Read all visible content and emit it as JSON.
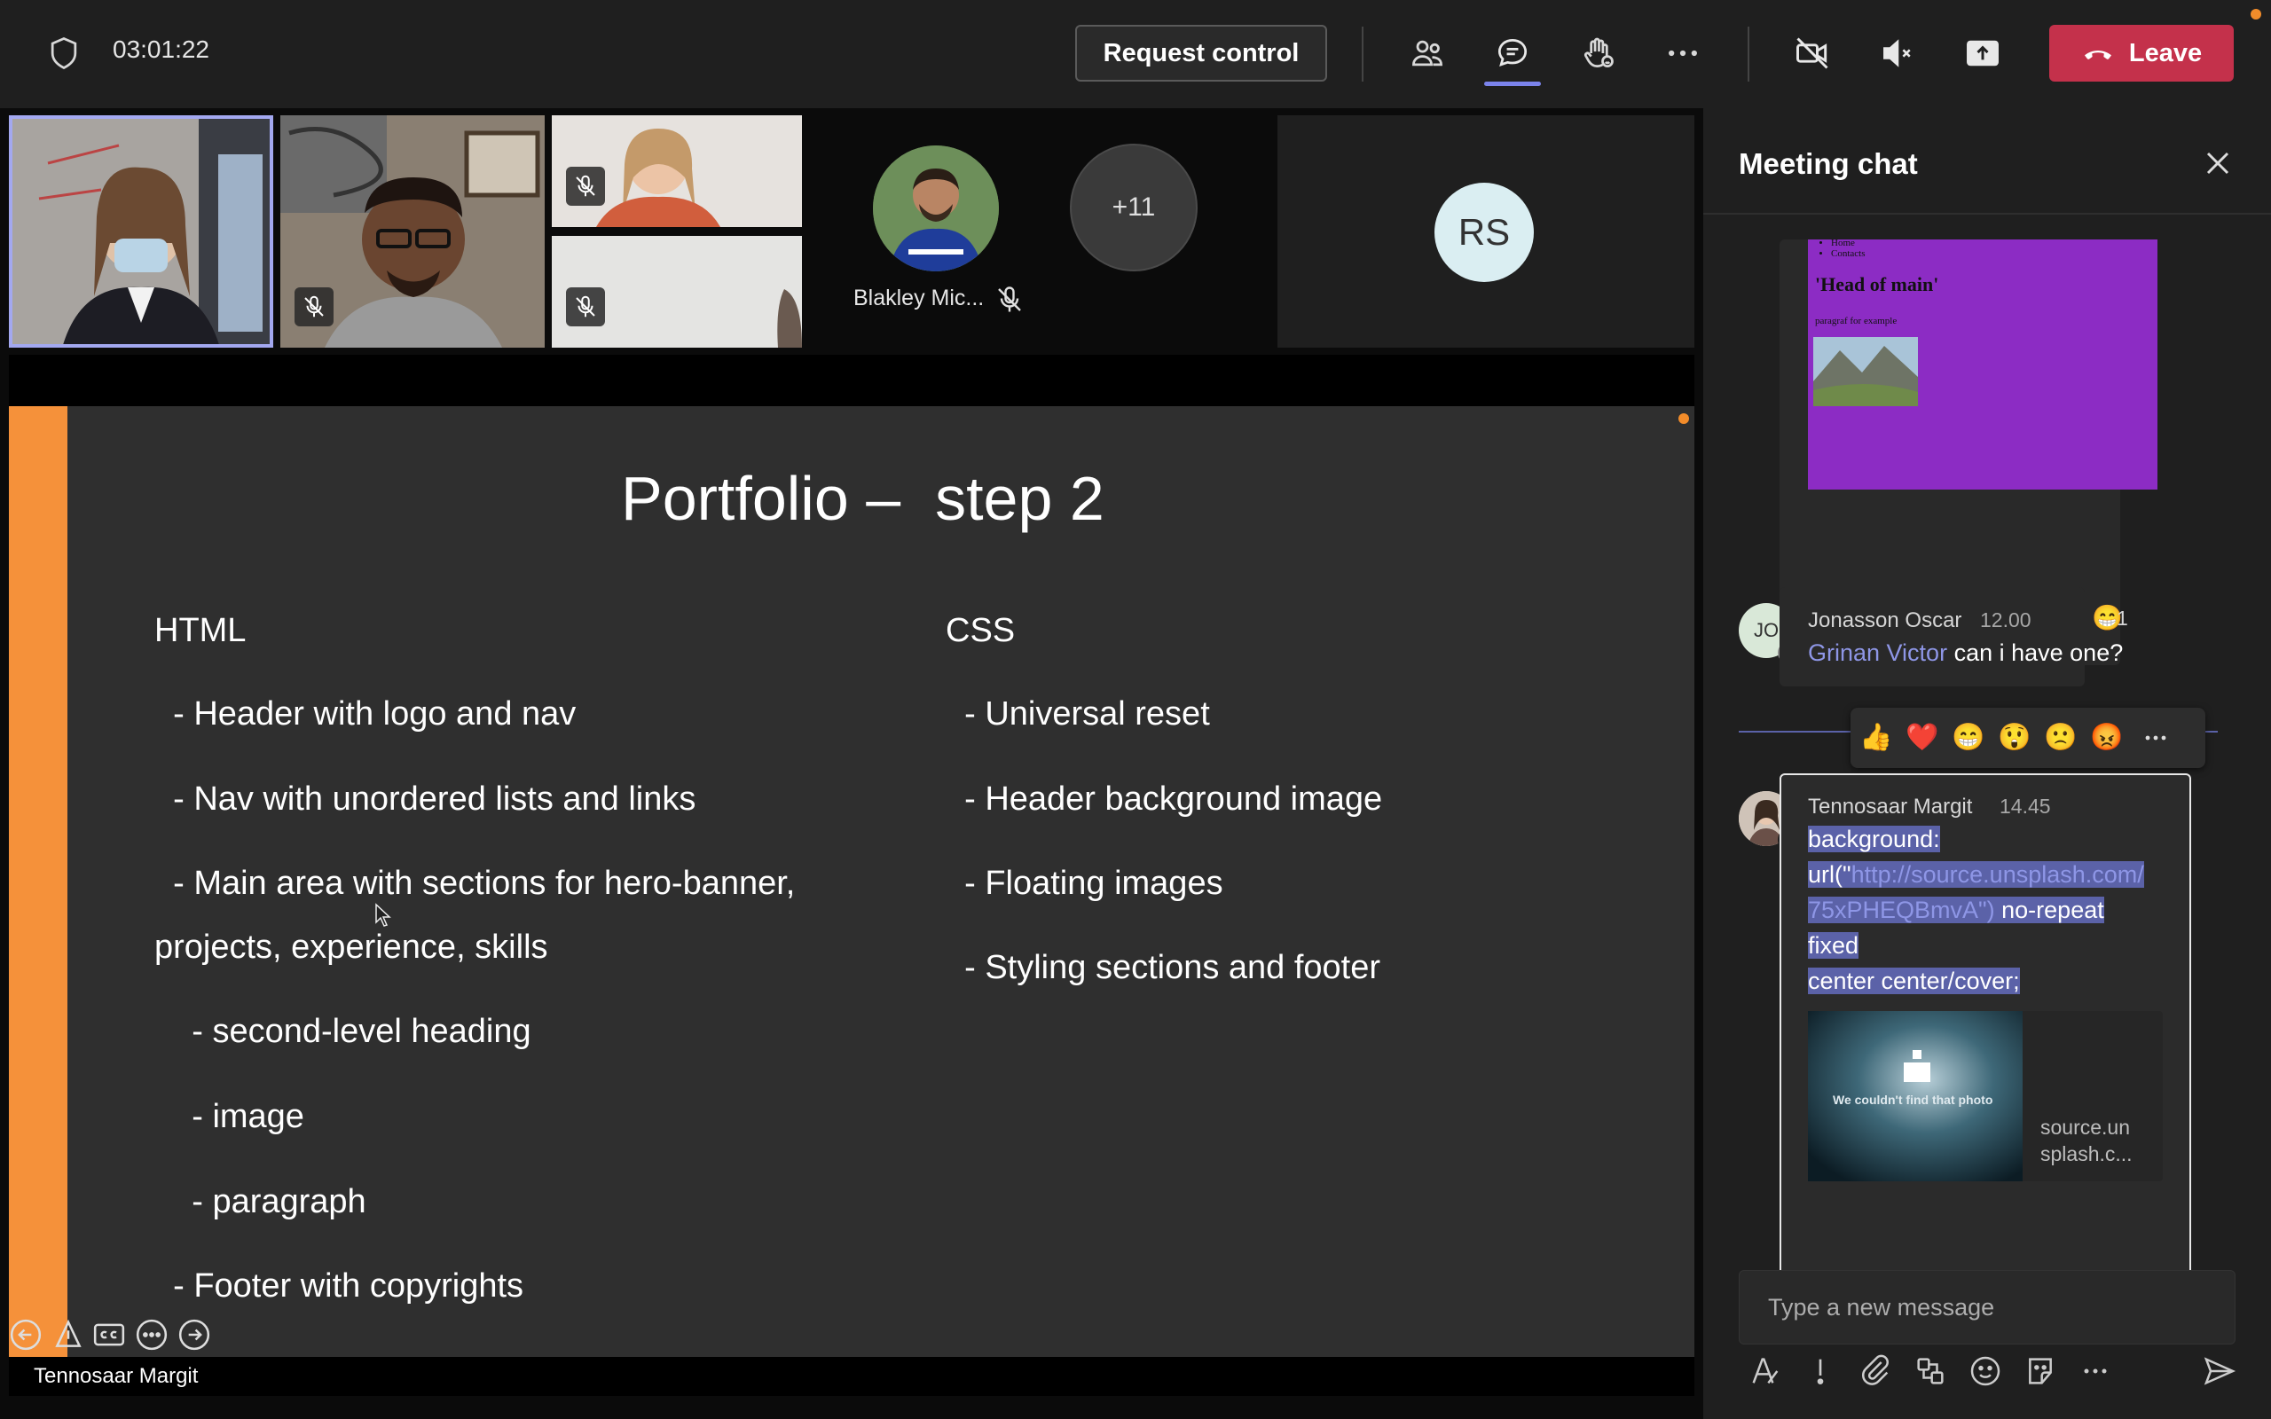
{
  "topbar": {
    "timer": "03:01:22",
    "request_control_label": "Request control",
    "leave_label": "Leave",
    "colors": {
      "leave": "#c4314b",
      "accent": "#7b83eb"
    }
  },
  "participants": {
    "blakley_name": "Blakley Mic...",
    "overflow_count": "+11",
    "rs_initials": "RS"
  },
  "slide": {
    "title": "Portfolio –  step 2",
    "html_heading": "HTML",
    "css_heading": "CSS",
    "html_items": [
      "  - Header with logo and nav",
      "  - Nav with unordered lists and links",
      "  - Main area with sections for hero-banner,",
      "projects, experience, skills",
      "    - second-level heading",
      "    - image",
      "    - paragraph",
      "  - Footer with copyrights"
    ],
    "css_items": [
      "  - Universal reset",
      "  - Header background image",
      "  - Floating images",
      "  - Styling sections and footer"
    ],
    "presenter_name": "Tennosaar Margit"
  },
  "chat": {
    "title": "Meeting chat",
    "preview": {
      "nav_items": [
        "Home",
        "Contacts"
      ],
      "heading": "'Head of main'",
      "paragraph": "paragraf for example"
    },
    "msg1": {
      "initials": "JO",
      "name": "Jonasson Oscar",
      "time": "12.00",
      "reaction_count": "1",
      "mention": "Grinan Victor",
      "text": " can i have one?"
    },
    "msg2": {
      "name": "Tennosaar Margit",
      "time": "14.45",
      "line1": "background:",
      "line2_prefix": "url(\"",
      "line2_link": "http://source.unsplash.com/",
      "line3_link": "75xPHEQBmvA\")",
      "line3_suffix": " no-repeat",
      "line4": "fixed",
      "line5": "center center/cover;",
      "image_caption": "We couldn't find that photo",
      "link_domain_1": "source.un",
      "link_domain_2": "splash.c..."
    },
    "compose_placeholder": "Type a new message"
  }
}
